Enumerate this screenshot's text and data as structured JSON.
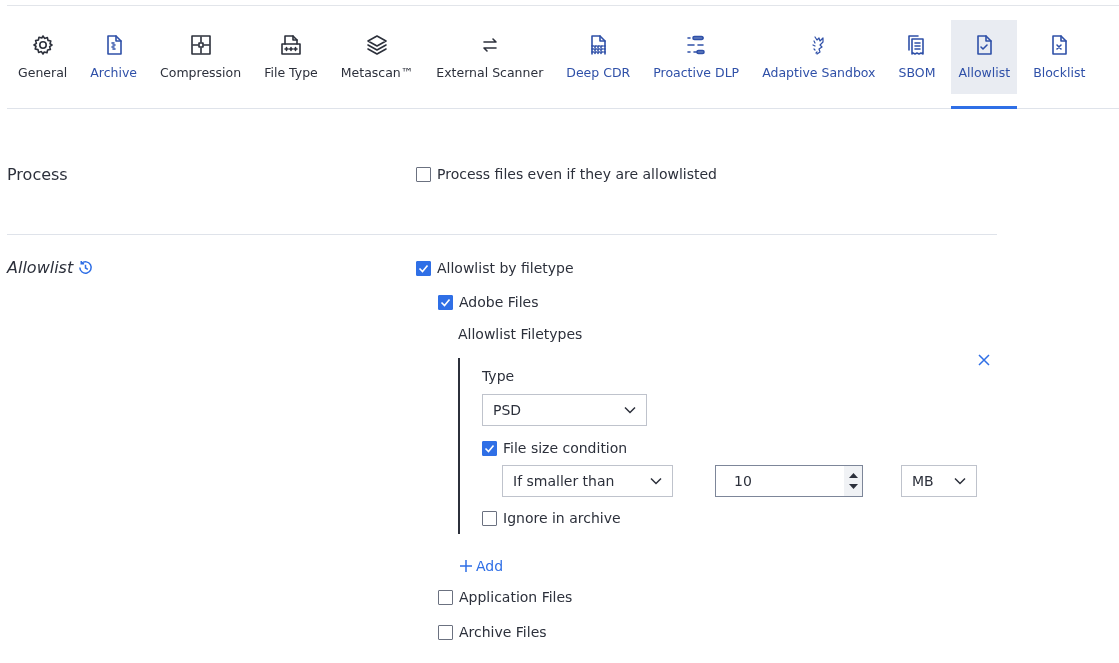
{
  "tabs": [
    {
      "label": "General",
      "selected": false,
      "modified": false
    },
    {
      "label": "Archive",
      "selected": false,
      "modified": true
    },
    {
      "label": "Compression",
      "selected": false,
      "modified": false
    },
    {
      "label": "File Type",
      "selected": false,
      "modified": false
    },
    {
      "label": "Metascan™",
      "selected": false,
      "modified": false
    },
    {
      "label": "External Scanner",
      "selected": false,
      "modified": false
    },
    {
      "label": "Deep CDR",
      "selected": false,
      "modified": true
    },
    {
      "label": "Proactive DLP",
      "selected": false,
      "modified": true
    },
    {
      "label": "Adaptive Sandbox",
      "selected": false,
      "modified": true
    },
    {
      "label": "SBOM",
      "selected": false,
      "modified": true
    },
    {
      "label": "Allowlist",
      "selected": true,
      "modified": true
    },
    {
      "label": "Blocklist",
      "selected": false,
      "modified": true
    }
  ],
  "process": {
    "label": "Process",
    "option": {
      "label": "Process files even if they are allowlisted",
      "checked": false
    }
  },
  "allowlist": {
    "label": "Allowlist",
    "by_filetype": {
      "label": "Allowlist by filetype",
      "checked": true
    },
    "groups": [
      {
        "label": "Adobe Files",
        "checked": true,
        "filetypes_title": "Allowlist Filetypes",
        "add_label": "Add",
        "entries": [
          {
            "type_label": "Type",
            "type_value": "PSD",
            "size_condition": {
              "label": "File size condition",
              "checked": true
            },
            "condition": "If smaller than",
            "size": "10",
            "unit": "MB",
            "ignore_archive": {
              "label": "Ignore in archive",
              "checked": false
            }
          }
        ]
      },
      {
        "label": "Application Files",
        "checked": false
      },
      {
        "label": "Archive Files",
        "checked": false
      }
    ]
  }
}
